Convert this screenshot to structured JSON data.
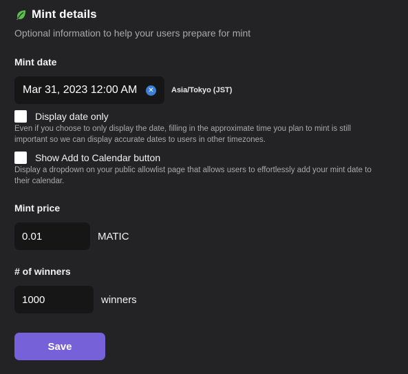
{
  "header": {
    "icon": "leaf-icon",
    "title": "Mint details",
    "subtitle": "Optional information to help your users prepare for mint"
  },
  "mint_date": {
    "label": "Mint date",
    "value": "Mar 31, 2023 12:00 AM",
    "clear_icon": "close-icon",
    "timezone": "Asia/Tokyo (JST)"
  },
  "display_date_only": {
    "label": "Display date only",
    "checked": false,
    "help": "Even if you choose to only display the date, filling in the approximate time you plan to mint is still important so we can display accurate dates to users in other timezones."
  },
  "add_to_calendar": {
    "label": "Show Add to Calendar button",
    "checked": false,
    "help": "Display a dropdown on your public allowlist page that allows users to effortlessly add your mint date to their calendar."
  },
  "mint_price": {
    "label": "Mint price",
    "value": "0.01",
    "unit": "MATIC"
  },
  "winners": {
    "label": "# of winners",
    "value": "1000",
    "unit": "winners"
  },
  "save_label": "Save",
  "colors": {
    "background": "#232325",
    "input_background": "#161617",
    "accent": "#7661d8",
    "leaf": "#5bbf4e",
    "clear": "#3e7fd6"
  }
}
